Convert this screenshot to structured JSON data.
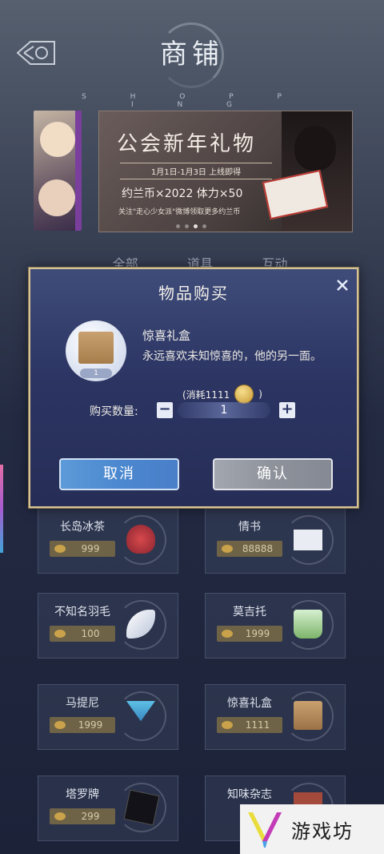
{
  "header": {
    "title": "商铺",
    "subtitle": "S H O P P I N G"
  },
  "banner": {
    "title": "公会新年礼物",
    "date": "1月1日-1月3日 上线即得",
    "reward": "约兰币×2022  体力×50",
    "note": "关注\"走心少女派\"微博领取更多约兰币"
  },
  "tabs": [
    "全部",
    "道具",
    "互动"
  ],
  "shop_items": [
    {
      "name": "长岛冰茶",
      "price": "999"
    },
    {
      "name": "情书",
      "price": "88888"
    },
    {
      "name": "不知名羽毛",
      "price": "100"
    },
    {
      "name": "莫吉托",
      "price": "1999"
    },
    {
      "name": "马提尼",
      "price": "1999"
    },
    {
      "name": "惊喜礼盒",
      "price": "1111"
    },
    {
      "name": "塔罗牌",
      "price": "299"
    },
    {
      "name": "知味杂志",
      "price": ""
    }
  ],
  "dialog": {
    "title": "物品购买",
    "close_icon": "close-icon",
    "item_name": "惊喜礼盒",
    "item_count": "1",
    "item_desc": "永远喜欢未知惊喜的，他的另一面。",
    "cost_prefix": "(消耗1111",
    "cost_suffix": ")",
    "qty_label": "购买数量:",
    "qty_minus": "−",
    "qty_value": "1",
    "qty_plus": "+",
    "cancel_label": "取消",
    "confirm_label": "确认"
  },
  "watermark": {
    "text": "游戏坊"
  },
  "colors": {
    "accent_gold": "#d9c393",
    "cancel_blue": "#4b88cf",
    "confirm_gray": "#8e929b",
    "modal_bg": "#2c3563"
  }
}
